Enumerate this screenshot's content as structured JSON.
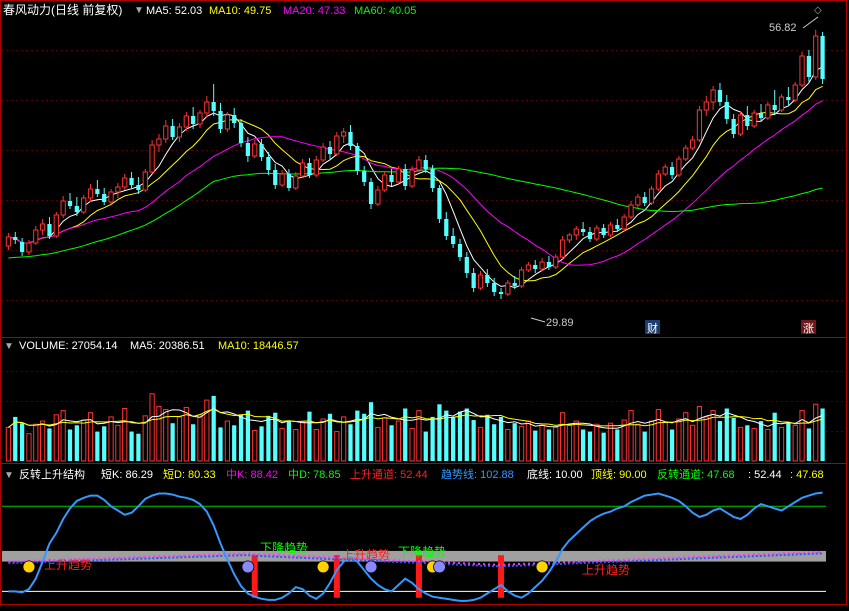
{
  "window": {
    "stock_title": "春风动力(日线 前复权)",
    "ma_labels": [
      {
        "text": "MA5: 52.03",
        "color": "#ffffff"
      },
      {
        "text": "MA10: 49.75",
        "color": "#ffff00"
      },
      {
        "text": "MA20: 47.33",
        "color": "#ff00ff"
      },
      {
        "text": "MA60: 40.05",
        "color": "#00ff00"
      }
    ]
  },
  "price_panel": {
    "high_marker": "56.82",
    "low_marker": "29.89",
    "badge_cai": "财",
    "badge_zhang": "涨"
  },
  "volume_panel": {
    "labels": [
      {
        "text": "VOLUME: 27054.14",
        "color": "#ffffff"
      },
      {
        "text": "MA5: 20386.51",
        "color": "#ffffff"
      },
      {
        "text": "MA10: 18446.57",
        "color": "#ffff00"
      }
    ]
  },
  "indicator_panel": {
    "labels": [
      {
        "text": "反转上升结构",
        "color": "#ffffff"
      },
      {
        "text": "短K: 86.29",
        "color": "#ffffff"
      },
      {
        "text": "短D: 80.33",
        "color": "#ffff00"
      },
      {
        "text": "中K: 88.42",
        "color": "#ff00ff"
      },
      {
        "text": "中D: 78.85",
        "color": "#00ff00"
      },
      {
        "text": "上升通道: 52.44",
        "color": "#ff2020"
      },
      {
        "text": "趋势线: 102.88",
        "color": "#3399ff"
      },
      {
        "text": "底线: 10.00",
        "color": "#ffffff"
      },
      {
        "text": "顶线: 90.00",
        "color": "#ffff00"
      },
      {
        "text": "反转通道: 47.68",
        "color": "#00ff00"
      },
      {
        "text": ": 52.44",
        "color": "#ffffff"
      },
      {
        "text": ": 47.68",
        "color": "#ffff00"
      }
    ],
    "annotations": [
      {
        "text": "上升趋势",
        "color": "#ff2020"
      },
      {
        "text": "下降趋势",
        "color": "#00ff00"
      },
      {
        "text": "上升趋势",
        "color": "#ff2020"
      },
      {
        "text": "下降趋势",
        "color": "#00ff00"
      },
      {
        "text": "上升趋势",
        "color": "#ff2020"
      }
    ]
  },
  "chart_data": {
    "type": "candlestick",
    "bar_count": 120,
    "price_range": [
      28,
      58
    ],
    "ohlc": [
      [
        35.2,
        36.5,
        34.8,
        36.1
      ],
      [
        36.1,
        36.6,
        35.4,
        35.8
      ],
      [
        35.6,
        36.0,
        34.2,
        34.6
      ],
      [
        34.6,
        35.8,
        34.3,
        35.5
      ],
      [
        35.5,
        37.2,
        35.3,
        36.8
      ],
      [
        36.8,
        37.9,
        36.3,
        37.4
      ],
      [
        37.4,
        38.1,
        35.9,
        36.2
      ],
      [
        36.2,
        38.6,
        36.0,
        38.3
      ],
      [
        38.3,
        40.2,
        38.0,
        39.7
      ],
      [
        39.7,
        40.5,
        38.9,
        39.2
      ],
      [
        39.2,
        40.1,
        38.2,
        38.6
      ],
      [
        38.6,
        40.3,
        38.4,
        40.0
      ],
      [
        40.0,
        41.4,
        39.6,
        40.9
      ],
      [
        40.9,
        41.8,
        40.1,
        40.4
      ],
      [
        40.4,
        41.0,
        39.3,
        39.6
      ],
      [
        39.6,
        40.9,
        39.4,
        40.6
      ],
      [
        40.6,
        41.5,
        40.0,
        41.1
      ],
      [
        41.1,
        42.4,
        40.8,
        42.0
      ],
      [
        42.0,
        42.6,
        40.9,
        41.3
      ],
      [
        41.3,
        42.1,
        40.4,
        40.8
      ],
      [
        40.8,
        42.9,
        40.6,
        42.6
      ],
      [
        42.6,
        45.8,
        42.4,
        45.3
      ],
      [
        45.3,
        46.4,
        44.6,
        45.9
      ],
      [
        45.9,
        47.8,
        45.5,
        47.2
      ],
      [
        47.2,
        47.9,
        45.8,
        46.1
      ],
      [
        46.1,
        47.5,
        45.6,
        47.1
      ],
      [
        47.1,
        48.6,
        46.7,
        48.2
      ],
      [
        48.2,
        49.1,
        46.9,
        47.4
      ],
      [
        47.4,
        48.8,
        47.0,
        48.5
      ],
      [
        48.5,
        50.2,
        48.1,
        49.6
      ],
      [
        49.6,
        51.4,
        48.2,
        48.7
      ],
      [
        48.7,
        49.5,
        46.5,
        46.9
      ],
      [
        46.9,
        48.6,
        46.6,
        48.3
      ],
      [
        48.3,
        49.0,
        47.0,
        47.5
      ],
      [
        47.5,
        47.9,
        45.1,
        45.5
      ],
      [
        45.5,
        46.1,
        43.6,
        44.2
      ],
      [
        44.2,
        45.8,
        44.0,
        45.4
      ],
      [
        45.4,
        45.9,
        43.7,
        44.1
      ],
      [
        44.1,
        44.6,
        42.3,
        42.8
      ],
      [
        42.8,
        43.4,
        40.9,
        41.3
      ],
      [
        41.3,
        42.8,
        41.1,
        42.4
      ],
      [
        42.4,
        42.9,
        40.7,
        41.0
      ],
      [
        41.0,
        42.6,
        40.8,
        42.2
      ],
      [
        42.2,
        43.9,
        42.0,
        43.5
      ],
      [
        43.5,
        44.0,
        42.0,
        42.3
      ],
      [
        42.3,
        44.2,
        42.1,
        43.8
      ],
      [
        43.8,
        45.5,
        43.6,
        45.1
      ],
      [
        45.1,
        45.7,
        43.9,
        44.4
      ],
      [
        44.4,
        46.6,
        44.2,
        46.2
      ],
      [
        46.2,
        47.0,
        45.5,
        46.6
      ],
      [
        46.6,
        47.3,
        44.8,
        45.2
      ],
      [
        45.2,
        45.5,
        42.3,
        42.7
      ],
      [
        42.7,
        43.2,
        41.2,
        41.6
      ],
      [
        41.6,
        42.0,
        38.9,
        39.4
      ],
      [
        39.4,
        41.2,
        39.2,
        40.8
      ],
      [
        40.8,
        42.7,
        40.6,
        42.3
      ],
      [
        42.3,
        42.9,
        41.2,
        41.6
      ],
      [
        41.6,
        43.2,
        41.4,
        42.9
      ],
      [
        42.9,
        43.4,
        40.8,
        41.2
      ],
      [
        41.2,
        43.2,
        41.0,
        42.8
      ],
      [
        42.8,
        44.2,
        42.6,
        43.8
      ],
      [
        43.8,
        44.3,
        42.5,
        42.9
      ],
      [
        42.9,
        43.3,
        40.6,
        41.0
      ],
      [
        41.0,
        41.3,
        37.5,
        37.9
      ],
      [
        37.9,
        38.6,
        35.8,
        36.2
      ],
      [
        36.2,
        37.0,
        35.0,
        35.4
      ],
      [
        35.4,
        35.9,
        33.7,
        34.1
      ],
      [
        34.1,
        34.6,
        32.0,
        32.5
      ],
      [
        32.5,
        33.0,
        30.6,
        31.0
      ],
      [
        31.0,
        32.7,
        30.8,
        32.3
      ],
      [
        32.3,
        32.9,
        31.1,
        31.5
      ],
      [
        31.5,
        32.0,
        30.2,
        30.6
      ],
      [
        30.6,
        31.0,
        29.89,
        30.4
      ],
      [
        30.4,
        31.8,
        30.2,
        31.5
      ],
      [
        31.5,
        32.2,
        30.9,
        31.2
      ],
      [
        31.2,
        33.1,
        31.0,
        32.8
      ],
      [
        32.8,
        33.6,
        32.6,
        33.3
      ],
      [
        33.3,
        33.8,
        32.5,
        32.9
      ],
      [
        32.9,
        34.0,
        32.7,
        33.6
      ],
      [
        33.6,
        34.2,
        32.8,
        33.1
      ],
      [
        33.1,
        34.4,
        32.9,
        34.1
      ],
      [
        34.1,
        36.2,
        33.9,
        35.8
      ],
      [
        35.8,
        36.5,
        35.5,
        36.3
      ],
      [
        36.3,
        37.2,
        35.8,
        36.9
      ],
      [
        36.9,
        37.6,
        36.2,
        36.6
      ],
      [
        36.6,
        37.1,
        35.6,
        35.9
      ],
      [
        35.9,
        37.3,
        35.7,
        37.0
      ],
      [
        37.0,
        37.4,
        36.0,
        36.3
      ],
      [
        36.3,
        37.6,
        36.1,
        37.3
      ],
      [
        37.3,
        37.9,
        36.6,
        36.9
      ],
      [
        36.9,
        38.4,
        36.7,
        38.1
      ],
      [
        38.1,
        39.7,
        37.9,
        39.3
      ],
      [
        39.3,
        40.4,
        39.0,
        40.1
      ],
      [
        40.1,
        40.6,
        39.2,
        39.5
      ],
      [
        39.5,
        41.2,
        39.3,
        40.9
      ],
      [
        40.9,
        42.8,
        40.7,
        42.4
      ],
      [
        42.4,
        43.4,
        42.2,
        43.1
      ],
      [
        43.1,
        43.6,
        41.9,
        42.3
      ],
      [
        42.3,
        44.2,
        42.1,
        43.9
      ],
      [
        43.9,
        45.3,
        43.7,
        45.0
      ],
      [
        45.0,
        46.2,
        44.8,
        45.8
      ],
      [
        45.8,
        49.2,
        45.6,
        48.8
      ],
      [
        48.8,
        50.2,
        48.2,
        49.6
      ],
      [
        49.6,
        51.2,
        48.8,
        50.8
      ],
      [
        50.8,
        51.5,
        49.2,
        49.6
      ],
      [
        49.6,
        50.3,
        47.4,
        47.9
      ],
      [
        47.9,
        48.4,
        46.0,
        46.4
      ],
      [
        46.4,
        48.6,
        46.2,
        48.3
      ],
      [
        48.3,
        49.2,
        46.8,
        47.2
      ],
      [
        47.2,
        48.8,
        47.0,
        48.5
      ],
      [
        48.5,
        49.4,
        47.6,
        48.0
      ],
      [
        48.0,
        49.6,
        47.8,
        49.3
      ],
      [
        49.3,
        50.8,
        48.4,
        48.8
      ],
      [
        48.8,
        50.4,
        48.6,
        50.1
      ],
      [
        50.1,
        51.1,
        49.3,
        49.8
      ],
      [
        49.8,
        51.6,
        49.6,
        51.3
      ],
      [
        51.3,
        54.6,
        51.1,
        54.2
      ],
      [
        54.2,
        54.8,
        51.6,
        52.1
      ],
      [
        52.1,
        56.82,
        51.8,
        56.2
      ],
      [
        56.2,
        56.6,
        51.4,
        51.9
      ]
    ],
    "volume": [
      16000,
      21000,
      18000,
      13000,
      17500,
      19000,
      15500,
      22000,
      24000,
      15000,
      17000,
      19500,
      23000,
      14000,
      16500,
      21000,
      17000,
      25000,
      14000,
      13000,
      21500,
      32000,
      26000,
      24500,
      18000,
      21000,
      25500,
      17500,
      22000,
      29000,
      31000,
      16000,
      19000,
      17000,
      22000,
      24000,
      14500,
      16500,
      21500,
      23000,
      15500,
      19000,
      15000,
      18500,
      23500,
      15000,
      20000,
      22500,
      14000,
      21000,
      17500,
      24000,
      22500,
      28000,
      16000,
      20500,
      17000,
      19000,
      25000,
      15500,
      24000,
      14000,
      21000,
      27000,
      24000,
      21000,
      23500,
      25000,
      19500,
      16000,
      22000,
      17500,
      21000,
      15000,
      18000,
      16500,
      19000,
      14500,
      17000,
      15000,
      16000,
      23000,
      17000,
      19000,
      15000,
      14000,
      17500,
      13500,
      18000,
      15000,
      19500,
      24000,
      17500,
      14000,
      19000,
      24500,
      18500,
      15000,
      20000,
      23000,
      17000,
      26000,
      21000,
      24000,
      19000,
      25000,
      20500,
      16000,
      17000,
      15500,
      19000,
      15000,
      23000,
      16000,
      18500,
      17000,
      24000,
      15500,
      27054,
      25000
    ],
    "volume_range": [
      0,
      50000
    ],
    "indicator_range": [
      0,
      110
    ],
    "indicator_lines": {
      "top_line": 90,
      "bottom_line": 10
    },
    "trend_line_values": [
      10,
      10,
      9,
      12,
      22,
      38,
      55,
      65,
      78,
      88,
      95,
      98,
      100,
      100,
      96,
      90,
      86,
      82,
      84,
      90,
      97,
      100,
      102,
      102,
      101,
      99,
      98,
      96,
      92,
      85,
      72,
      55,
      40,
      26,
      15,
      8,
      5,
      3,
      2,
      2,
      4,
      8,
      14,
      12,
      6,
      3,
      8,
      18,
      30,
      38,
      42,
      38,
      30,
      22,
      16,
      12,
      10,
      16,
      22,
      18,
      12,
      8,
      5,
      4,
      3,
      2,
      1,
      1,
      2,
      4,
      8,
      12,
      16,
      10,
      6,
      4,
      8,
      14,
      20,
      28,
      38,
      50,
      58,
      64,
      70,
      76,
      80,
      83,
      85,
      88,
      90,
      94,
      97,
      100,
      101,
      102,
      100,
      98,
      95,
      90,
      84,
      80,
      82,
      86,
      88,
      84,
      80,
      78,
      82,
      88,
      92,
      90,
      88,
      86,
      90,
      94,
      98,
      100,
      102,
      102.88
    ],
    "gray_band": [
      38,
      48
    ],
    "red_bar_indices": [
      36,
      48,
      60,
      72
    ]
  }
}
